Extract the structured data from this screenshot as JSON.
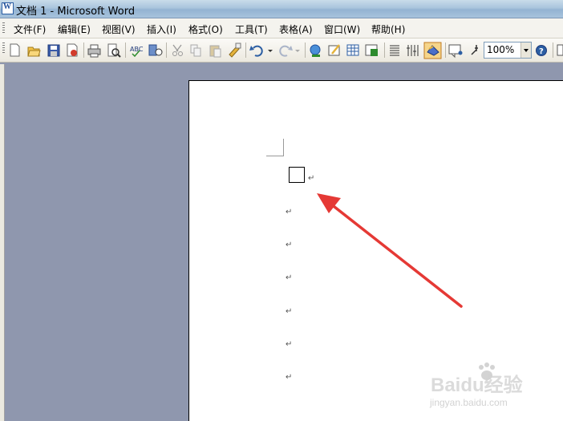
{
  "window": {
    "title": "文档 1 - Microsoft Word"
  },
  "menu": {
    "items": [
      {
        "label": "文件(F)"
      },
      {
        "label": "编辑(E)"
      },
      {
        "label": "视图(V)"
      },
      {
        "label": "插入(I)"
      },
      {
        "label": "格式(O)"
      },
      {
        "label": "工具(T)"
      },
      {
        "label": "表格(A)"
      },
      {
        "label": "窗口(W)"
      },
      {
        "label": "帮助(H)"
      }
    ]
  },
  "toolbar": {
    "zoom_value": "100%",
    "buttons": [
      "new-icon",
      "open-icon",
      "save-icon",
      "permission-icon",
      "print-icon",
      "print-preview-icon",
      "spelling-icon",
      "research-icon",
      "cut-icon",
      "copy-icon",
      "paste-icon",
      "format-painter-icon",
      "undo-icon",
      "redo-icon",
      "hyperlink-icon",
      "tables-borders-icon",
      "insert-table-icon",
      "insert-excel-icon",
      "columns-icon",
      "drawing-icon",
      "document-map-icon",
      "show-formatting-icon",
      "read-icon",
      "help-icon"
    ]
  },
  "document": {
    "paragraph_mark": "↵",
    "paragraph_count": 6
  },
  "watermark": {
    "brand": "Baidu经验",
    "url": "jingyan.baidu.com"
  },
  "colors": {
    "arrow": "#e53935",
    "workspace": "#8f97ae",
    "titlebar": "#a9c4dd"
  }
}
